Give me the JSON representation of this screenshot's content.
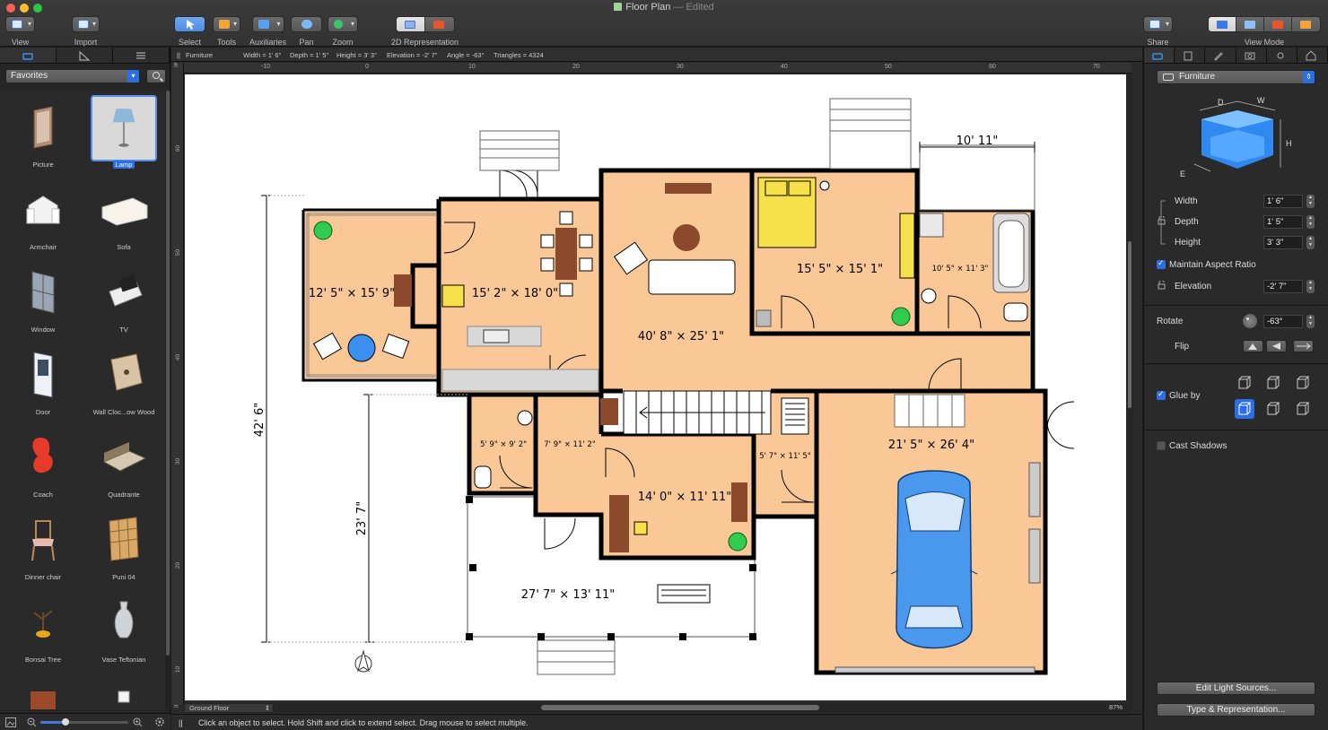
{
  "window": {
    "title": "Floor Plan",
    "subtitle": "— Edited"
  },
  "toolbar": {
    "view": "View",
    "import": "Import",
    "select": "Select",
    "tools": "Tools",
    "auxiliaries": "Auxiliaries",
    "pan": "Pan",
    "zoom": "Zoom",
    "representation": "2D Representation",
    "share": "Share",
    "view_mode": "View Mode"
  },
  "library": {
    "category": "Favorites",
    "items": [
      {
        "label": "Picture"
      },
      {
        "label": "Lamp"
      },
      {
        "label": "Armchair"
      },
      {
        "label": "Sofa"
      },
      {
        "label": "Window"
      },
      {
        "label": "TV"
      },
      {
        "label": "Door"
      },
      {
        "label": "Wall Cloc...ow Wood"
      },
      {
        "label": "Coach"
      },
      {
        "label": "Quadrante"
      },
      {
        "label": "Dinner chair"
      },
      {
        "label": "Puni 04"
      },
      {
        "label": "Bonsai Tree"
      },
      {
        "label": "Vase Teftonian"
      }
    ]
  },
  "infobar": {
    "object": "Furniture",
    "width": "Width = 1' 6\"",
    "depth": "Depth = 1' 5\"",
    "height": "Height = 3' 3\"",
    "elevation": "Elevation = -2' 7\"",
    "angle": "Angle = -63°",
    "triangles": "Triangles = 4324"
  },
  "ruler": {
    "unit": "ft",
    "h_ticks": [
      "-10",
      "0",
      "10",
      "20",
      "30",
      "40",
      "50",
      "60",
      "70"
    ],
    "v_ticks": [
      "60",
      "50",
      "40",
      "30",
      "20",
      "10",
      "0"
    ]
  },
  "plan": {
    "rooms": [
      "12' 5\" × 15' 9\"",
      "15' 2\" × 18' 0\"",
      "40' 8\" × 25' 1\"",
      "15' 5\" × 15' 1\"",
      "10' 5\" × 11' 3\"",
      "5' 9\" × 9' 2\"",
      "7' 9\" × 11' 2\"",
      "14' 0\" × 11' 11\"",
      "5' 7\" × 11' 5\"",
      "21' 5\" × 26' 4\"",
      "27' 7\" × 13' 11\""
    ],
    "dimensions": {
      "top": "10' 11\"",
      "left_total": "42' 6\"",
      "left_lower": "23' 7\""
    }
  },
  "bottom": {
    "floor": "Ground Floor",
    "zoom": "87%"
  },
  "status": "Click an object to select. Hold Shift and click to extend select. Drag mouse to select multiple.",
  "inspector": {
    "category": "Furniture",
    "diagram_labels": {
      "d": "D",
      "w": "W",
      "h": "H",
      "e": "E"
    },
    "width_label": "Width",
    "width_value": "1' 6\"",
    "depth_label": "Depth",
    "depth_value": "1' 5\"",
    "height_label": "Height",
    "height_value": "3' 3\"",
    "maintain_ratio": "Maintain Aspect Ratio",
    "elevation_label": "Elevation",
    "elevation_value": "-2' 7\"",
    "rotate_label": "Rotate",
    "rotate_value": "-63°",
    "flip_label": "Flip",
    "glue_label": "Glue by",
    "cast_shadows": "Cast Shadows",
    "edit_lights": "Edit Light Sources...",
    "type_repr": "Type & Representation..."
  },
  "colors": {
    "accent": "#2c6ee8",
    "room_fill": "#fac896",
    "wall": "#000000"
  }
}
